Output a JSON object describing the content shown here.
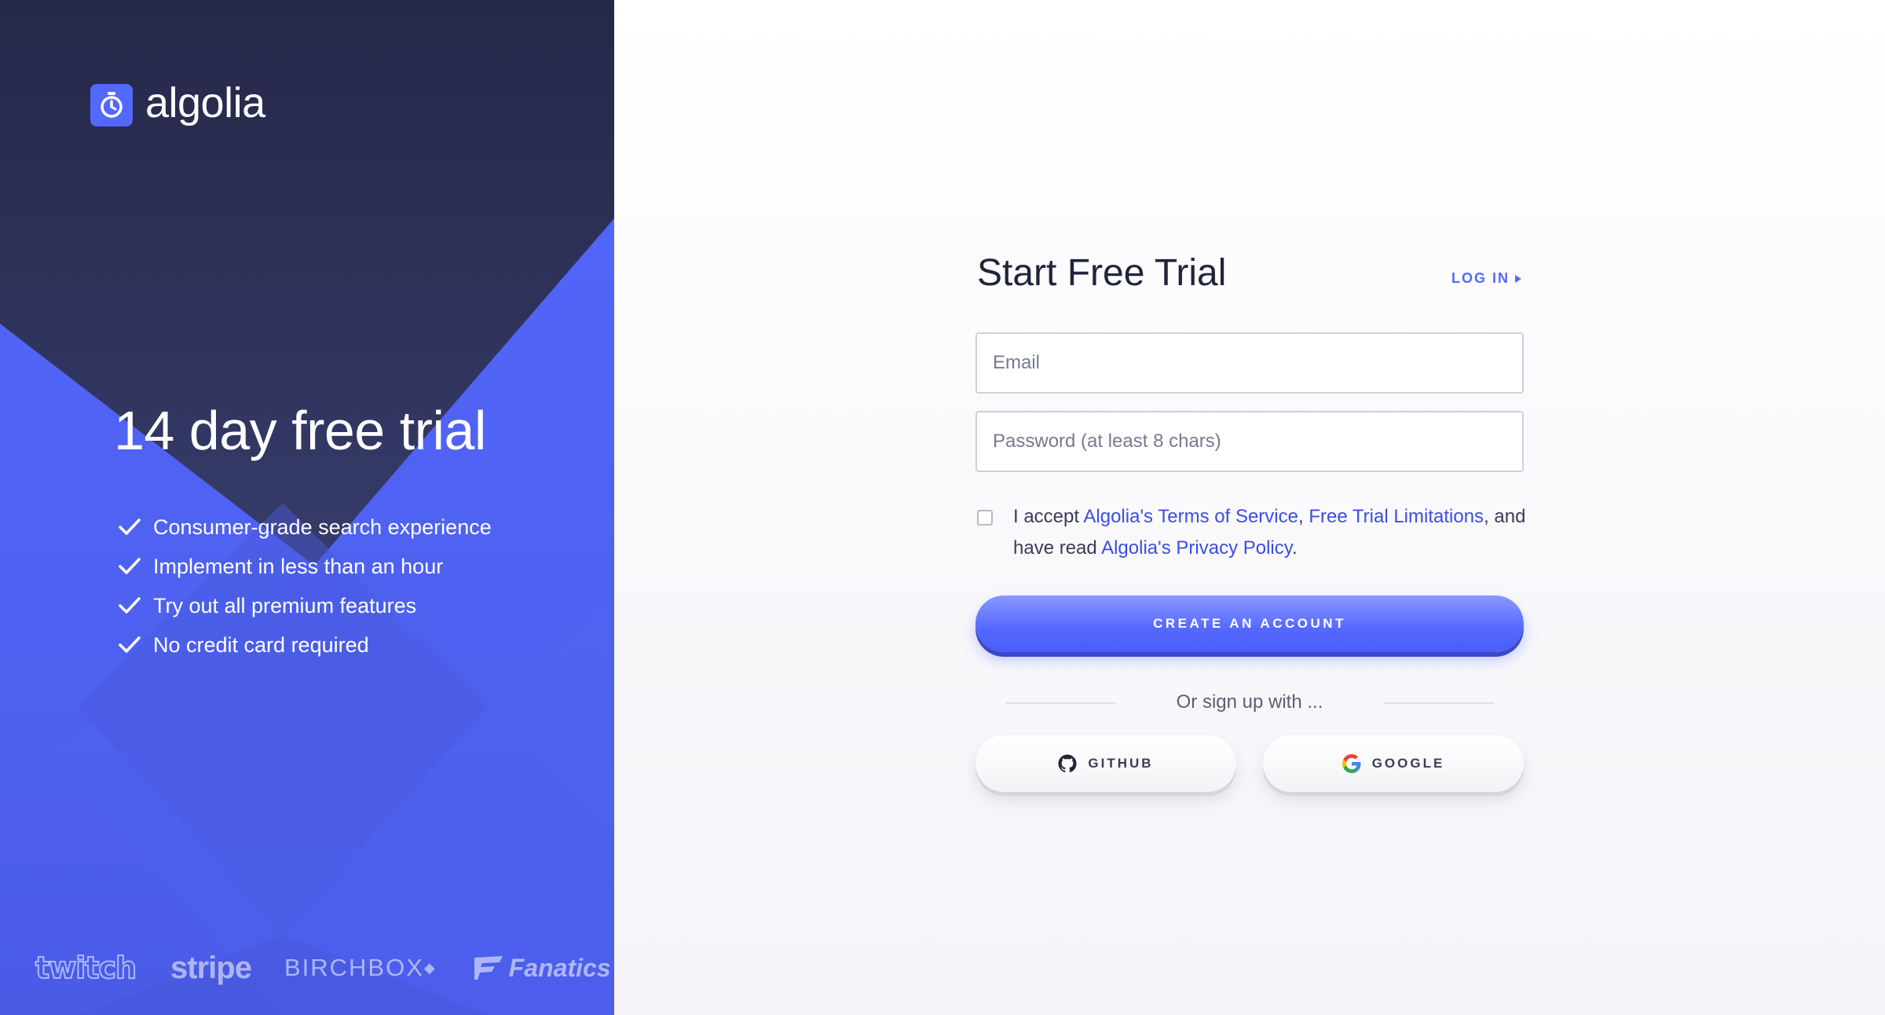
{
  "brand": {
    "name": "algolia",
    "logo_icon": "stopwatch-icon",
    "accent": "#5468ff",
    "dark": "#21243d"
  },
  "hero": {
    "title": "14 day free trial",
    "features": [
      "Consumer-grade search experience",
      "Implement in less than an hour",
      "Try out all premium features",
      "No credit card required"
    ],
    "customer_logos": [
      "twitch",
      "stripe",
      "BIRCHBOX",
      "Fanatics"
    ]
  },
  "form": {
    "title": "Start Free Trial",
    "login_label": "LOG IN",
    "email_placeholder": "Email",
    "password_placeholder": "Password (at least 8 chars)",
    "terms": {
      "prefix": "I accept ",
      "tos_link": "Algolia's Terms of Service",
      "sep1": ", ",
      "limits_link": "Free Trial Limitations",
      "mid": ", and have read ",
      "privacy_link": "Algolia's Privacy Policy",
      "suffix": "."
    },
    "create_label": "CREATE AN ACCOUNT",
    "divider_text": "Or sign up with ...",
    "github_label": "GITHUB",
    "google_label": "GOOGLE"
  }
}
